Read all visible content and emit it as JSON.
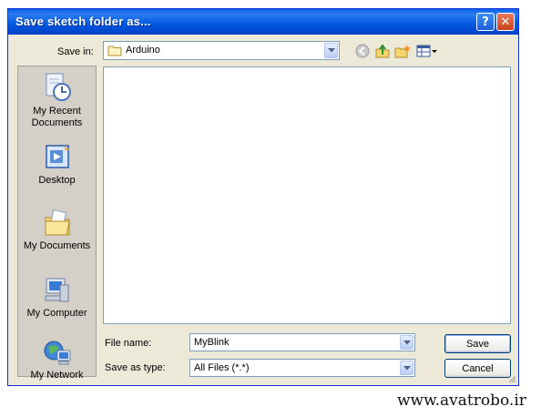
{
  "window": {
    "title": "Save sketch folder as...",
    "help_label": "?",
    "close_label": "✕"
  },
  "toolbar": {
    "save_in_label": "Save in:",
    "location": "Arduino",
    "icons": [
      "back-icon",
      "up-folder-icon",
      "new-folder-icon",
      "view-menu-icon"
    ]
  },
  "places": {
    "recent": "My Recent Documents",
    "desktop": "Desktop",
    "documents": "My Documents",
    "computer": "My Computer",
    "network": "My Network"
  },
  "form": {
    "file_name_label": "File name:",
    "file_name_value": "MyBlink",
    "save_as_type_label": "Save as type:",
    "save_as_type_value": "All Files (*.*)",
    "save_label": "Save",
    "cancel_label": "Cancel"
  },
  "watermark": "www.avatrobo.ir",
  "colors": {
    "title_bar": "#0058e0",
    "dialog_bg": "#ece9d8",
    "close_button": "#c8421d"
  }
}
